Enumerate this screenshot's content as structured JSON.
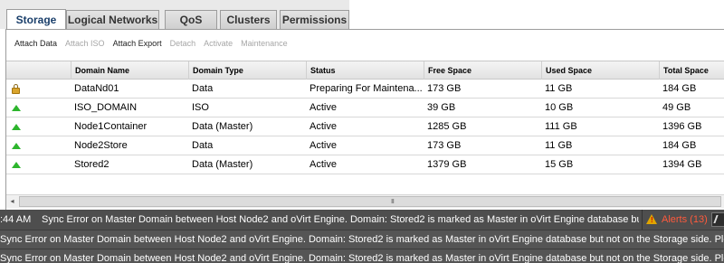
{
  "tabs": [
    {
      "label": "Storage",
      "active": true
    },
    {
      "label": "Logical Networks",
      "active": false
    },
    {
      "label": "QoS",
      "active": false
    },
    {
      "label": "Clusters",
      "active": false
    },
    {
      "label": "Permissions",
      "active": false
    }
  ],
  "toolbar": {
    "attach_data": "Attach Data",
    "attach_iso": "Attach ISO",
    "attach_export": "Attach Export",
    "detach": "Detach",
    "activate": "Activate",
    "maintenance": "Maintenance"
  },
  "columns": {
    "domain_name": "Domain Name",
    "domain_type": "Domain Type",
    "status": "Status",
    "free_space": "Free Space",
    "used_space": "Used Space",
    "total_space": "Total Space"
  },
  "rows": [
    {
      "status_icon": "lock-icon",
      "name": "DataNd01",
      "type": "Data",
      "status": "Preparing For Maintena...",
      "free": "173 GB",
      "used": "11 GB",
      "total": "184 GB"
    },
    {
      "status_icon": "up-arrow-icon",
      "name": "ISO_DOMAIN",
      "type": "ISO",
      "status": "Active",
      "free": "39 GB",
      "used": "10 GB",
      "total": "49 GB"
    },
    {
      "status_icon": "up-arrow-icon",
      "name": "Node1Container",
      "type": "Data (Master)",
      "status": "Active",
      "free": "1285 GB",
      "used": "111 GB",
      "total": "1396 GB"
    },
    {
      "status_icon": "up-arrow-icon",
      "name": "Node2Store",
      "type": "Data",
      "status": "Active",
      "free": "173 GB",
      "used": "11 GB",
      "total": "184 GB"
    },
    {
      "status_icon": "up-arrow-icon",
      "name": "Stored2",
      "type": "Data (Master)",
      "status": "Active",
      "free": "1379 GB",
      "used": "15 GB",
      "total": "1394 GB"
    }
  ],
  "scrollbar": {
    "left_arrow": "◂",
    "grip": "III"
  },
  "events": {
    "latest_time": ":44 AM",
    "latest_message": "Sync Error on Master Domain between Host Node2 and oVirt Engine. Domain: Stored2 is marked as Master in oVirt Engine database but n...",
    "alerts_label": "Alerts (13)",
    "lines": [
      "Sync Error on Master Domain between Host Node2 and oVirt Engine. Domain: Stored2 is marked as Master in oVirt Engine database but not on the Storage side. Please co",
      "Sync Error on Master Domain between Host Node2 and oVirt Engine. Domain: Stored2 is marked as Master in oVirt Engine database but not on the Storage side. Please co"
    ]
  },
  "colors": {
    "active_green": "#2db52d",
    "alert_red": "#ff5a3c",
    "event_bg": "#4e4e4e"
  }
}
